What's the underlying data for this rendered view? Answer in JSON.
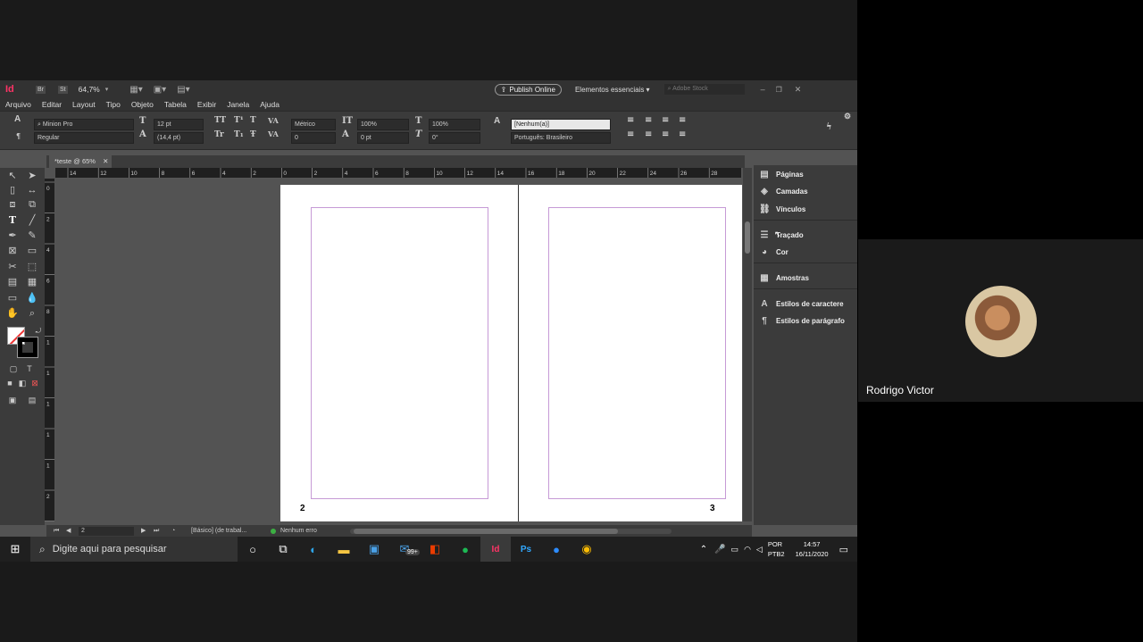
{
  "appbar": {
    "logo": "Id",
    "bridge": "Br",
    "stock": "St",
    "zoom": "64,7%",
    "publish_online": "Publish Online",
    "workspace": "Elementos essenciais",
    "search_placeholder": "Adobe Stock"
  },
  "menu": [
    "Arquivo",
    "Editar",
    "Layout",
    "Tipo",
    "Objeto",
    "Tabela",
    "Exibir",
    "Janela",
    "Ajuda"
  ],
  "control": {
    "font_family": "Minion Pro",
    "font_style": "Regular",
    "font_size": "12 pt",
    "leading": "(14,4 pt)",
    "kerning": "Métrico",
    "tracking": "0",
    "vscale": "100%",
    "hscale": "100%",
    "baseline": "0 pt",
    "skew": "0°",
    "char_style": "[Nenhum(a)]",
    "language": "Português: Brasileiro"
  },
  "document": {
    "tab_title": "*teste @ 65%",
    "page_left_number": "2",
    "page_right_number": "3"
  },
  "ruler": {
    "h_ticks": [
      "14",
      "12",
      "10",
      "8",
      "6",
      "4",
      "2",
      "0",
      "2",
      "4",
      "6",
      "8",
      "10",
      "12",
      "14",
      "16",
      "18",
      "20",
      "22",
      "24",
      "26",
      "28"
    ],
    "v_ticks": [
      "0",
      "2",
      "4",
      "6",
      "8",
      "1",
      "1",
      "1",
      "1",
      "1",
      "2",
      "2"
    ]
  },
  "status": {
    "page": "2",
    "style": "[Básico] (de trabal...",
    "errors": "Nenhum erro"
  },
  "panels": {
    "group1": [
      "Páginas",
      "Camadas",
      "Vínculos"
    ],
    "group2": [
      "Traçado",
      "Cor"
    ],
    "group3": [
      "Amostras"
    ],
    "group4": [
      "Estilos de caractere",
      "Estilos de parágrafo"
    ]
  },
  "taskbar": {
    "search_placeholder": "Digite aqui para pesquisar",
    "lang": "POR",
    "layout": "PTB2",
    "time": "14:57",
    "date": "16/11/2020",
    "badge": "99+"
  },
  "video": {
    "participant_name": "Rodrigo Victor"
  },
  "colors": {
    "margin_guide": "#c69ad6",
    "indesign_red": "#ff3366",
    "app_bg": "#535353"
  }
}
